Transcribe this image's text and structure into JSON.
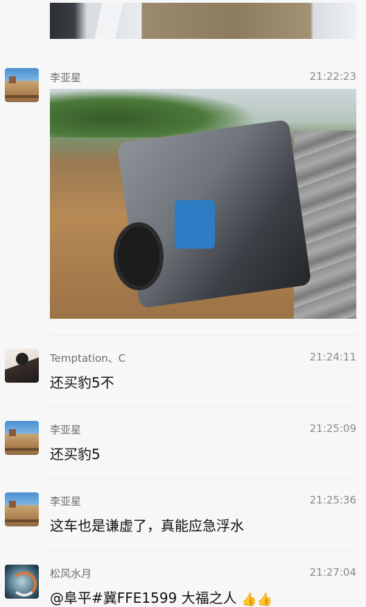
{
  "messages": [
    {
      "name": "李亚星",
      "time": "21:22:23",
      "image_alt": "",
      "avatar": "city-wall-avatar"
    },
    {
      "name": "Temptation、C",
      "time": "21:24:11",
      "text": "还买豹5不",
      "avatar": "person-avatar"
    },
    {
      "name": "李亚星",
      "time": "21:25:09",
      "text": "还买豹5",
      "avatar": "city-wall-avatar"
    },
    {
      "name": "李亚星",
      "time": "21:25:36",
      "text": "这车也是谦虚了，真能应急浮水",
      "avatar": "city-wall-avatar"
    },
    {
      "name": "松风水月",
      "time": "21:27:04",
      "text": "@阜平#冀FFE1599 大福之人",
      "emoji": "👍👍",
      "avatar": "swirl-avatar"
    }
  ],
  "colors": {
    "background": "#f7f7f7",
    "name": "#6e6e6e",
    "time": "#8c8c8c",
    "text": "#111111"
  }
}
